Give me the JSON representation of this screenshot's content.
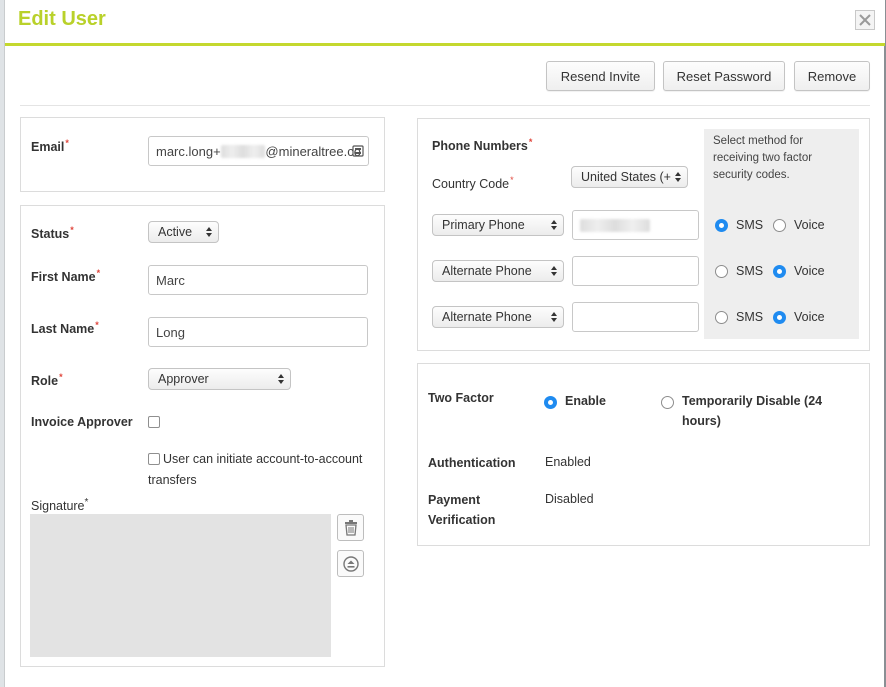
{
  "modal": {
    "title": "Edit User",
    "accent_color": "#c4d82e",
    "title_color": "#b9d12a",
    "close_icon": "close-icon"
  },
  "actions": {
    "resend_invite": "Resend Invite",
    "reset_password": "Reset Password",
    "remove": "Remove"
  },
  "email": {
    "label": "Email",
    "value_prefix": "marc.long+",
    "value_suffix": "@mineraltree.co"
  },
  "user": {
    "status_label": "Status",
    "status_value": "Active",
    "first_name_label": "First Name",
    "first_name_value": "Marc",
    "last_name_label": "Last Name",
    "last_name_value": "Long",
    "role_label": "Role",
    "role_value": "Approver",
    "invoice_approver_label": "Invoice Approver",
    "account_transfer_label_line1": "User can initiate account-to-account",
    "account_transfer_label_line2": "transfers",
    "signature_label": "Signature"
  },
  "phone": {
    "section_label": "Phone Numbers",
    "country_code_label": "Country Code",
    "country_code_value": "United States (+",
    "info_text_line1": "Select method for",
    "info_text_line2": "receiving two factor",
    "info_text_line3": "security codes.",
    "sms_label": "SMS",
    "voice_label": "Voice",
    "rows": [
      {
        "type": "Primary Phone",
        "method": "sms"
      },
      {
        "type": "Alternate Phone",
        "method": "voice"
      },
      {
        "type": "Alternate Phone",
        "method": "voice"
      }
    ]
  },
  "two_factor": {
    "label": "Two Factor",
    "enable_label": "Enable",
    "temp_disable_line1": "Temporarily Disable (24",
    "temp_disable_line2": "hours)",
    "selected": "enable",
    "authentication_label": "Authentication",
    "authentication_value": "Enabled",
    "payment_label_line1": "Payment",
    "payment_label_line2": "Verification",
    "payment_value": "Disabled",
    "radio_color": "#1f8bf0"
  }
}
